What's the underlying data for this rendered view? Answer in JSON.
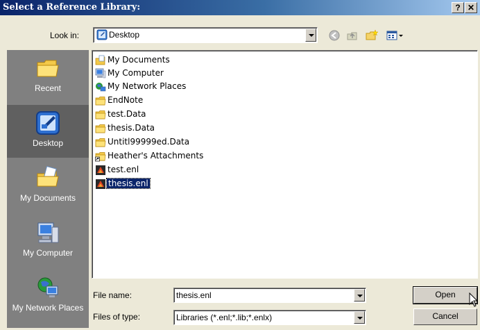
{
  "window": {
    "title": "Select a Reference Library:",
    "help_label": "?",
    "close_label": "✕"
  },
  "lookin": {
    "label": "Look in:",
    "value": "Desktop"
  },
  "places": [
    {
      "label": "Recent"
    },
    {
      "label": "Desktop"
    },
    {
      "label": "My Documents"
    },
    {
      "label": "My Computer"
    },
    {
      "label": "My Network Places"
    }
  ],
  "files": [
    {
      "name": "My Documents",
      "icon": "my-documents-icon"
    },
    {
      "name": "My Computer",
      "icon": "my-computer-icon"
    },
    {
      "name": "My Network Places",
      "icon": "network-places-icon"
    },
    {
      "name": "EndNote",
      "icon": "folder-icon"
    },
    {
      "name": "test.Data",
      "icon": "folder-icon"
    },
    {
      "name": "thesis.Data",
      "icon": "folder-icon"
    },
    {
      "name": "Untitl99999ed.Data",
      "icon": "folder-icon"
    },
    {
      "name": "Heather's Attachments",
      "icon": "folder-shortcut-icon"
    },
    {
      "name": "test.enl",
      "icon": "endnote-library-icon"
    },
    {
      "name": "thesis.enl",
      "icon": "endnote-library-icon",
      "selected": true
    }
  ],
  "filename": {
    "label": "File name:",
    "value": "thesis.enl"
  },
  "filetype": {
    "label": "Files of type:",
    "value": "Libraries (*.enl;*.lib;*.enlx)"
  },
  "buttons": {
    "open": "Open",
    "cancel": "Cancel"
  }
}
